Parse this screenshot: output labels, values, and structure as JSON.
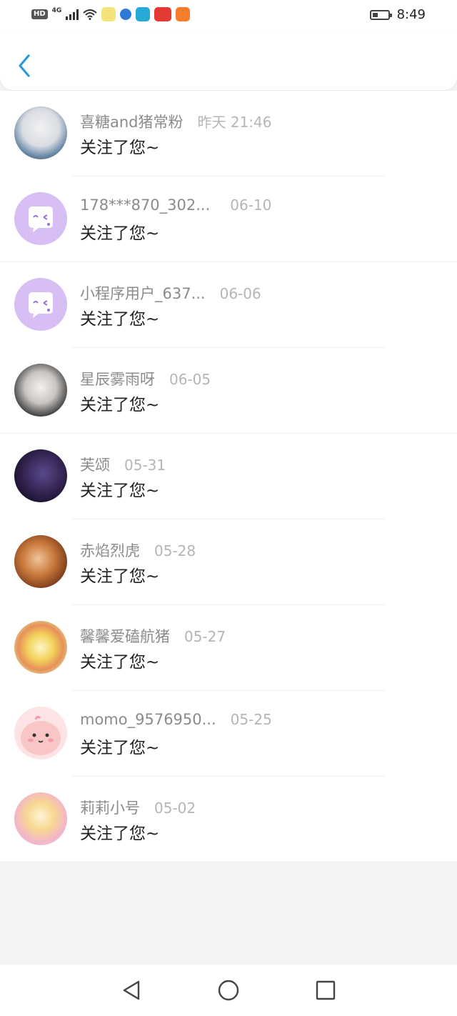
{
  "status_bar": {
    "hd_label": "HD",
    "network_label": "4G",
    "time": "8:49",
    "battery_level": 0.35
  },
  "header": {
    "back_icon": "chevron-left-icon",
    "accent": "#2a9ad8"
  },
  "notifications": [
    {
      "name": "喜糖and猪常粉",
      "time": "昨天 21:46",
      "message": "关注了您~"
    },
    {
      "name": "178***870_302...",
      "time": "06-10",
      "message": "关注了您~"
    },
    {
      "name": "小程序用户_637...",
      "time": "06-06",
      "message": "关注了您~"
    },
    {
      "name": "星辰雾雨呀",
      "time": "06-05",
      "message": "关注了您~"
    },
    {
      "name": "芙颂",
      "time": "05-31",
      "message": "关注了您~"
    },
    {
      "name": "赤焰烈虎",
      "time": "05-28",
      "message": "关注了您~"
    },
    {
      "name": "馨馨爱磕航猪",
      "time": "05-27",
      "message": "关注了您~"
    },
    {
      "name": "momo_9576950...",
      "time": "05-25",
      "message": "关注了您~"
    },
    {
      "name": "莉莉小号",
      "time": "05-02",
      "message": "关注了您~"
    }
  ],
  "nav": {
    "back": "triangle-back-icon",
    "home": "circle-home-icon",
    "recents": "square-recents-icon"
  }
}
